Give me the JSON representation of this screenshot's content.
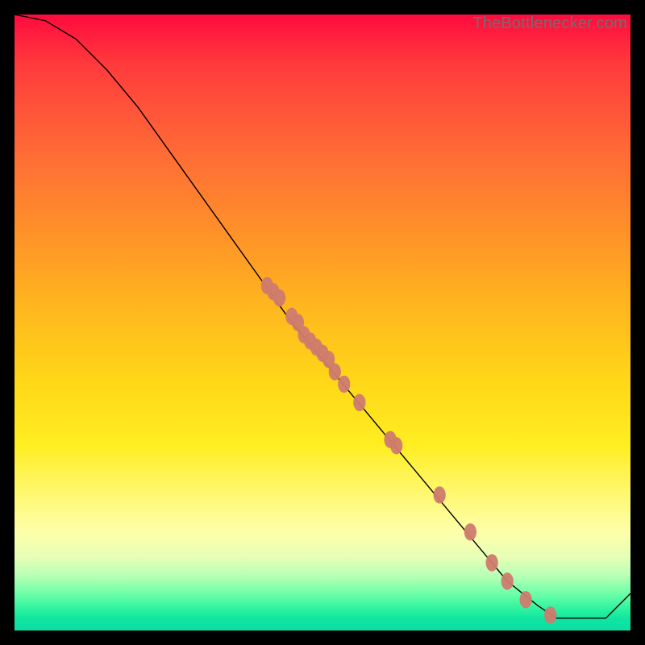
{
  "watermark": "TheBottlenecker.com",
  "chart_data": {
    "type": "line",
    "title": "",
    "xlabel": "",
    "ylabel": "",
    "xlim": [
      0,
      100
    ],
    "ylim": [
      0,
      100
    ],
    "grid": false,
    "curve": {
      "name": "bottleneck-curve",
      "color": "#000000",
      "x": [
        0,
        5,
        10,
        15,
        20,
        25,
        30,
        35,
        40,
        45,
        50,
        55,
        60,
        65,
        70,
        75,
        80,
        85,
        88,
        92,
        96,
        100
      ],
      "y": [
        100,
        99,
        96,
        91,
        85,
        78,
        71,
        64,
        57,
        50,
        44,
        38,
        32,
        26,
        20,
        14,
        8,
        4,
        2,
        2,
        2,
        6
      ]
    },
    "points": {
      "name": "sample-points",
      "color": "#cf7b6e",
      "data": [
        {
          "x": 41,
          "y": 56
        },
        {
          "x": 42,
          "y": 55
        },
        {
          "x": 43,
          "y": 54
        },
        {
          "x": 45,
          "y": 51
        },
        {
          "x": 46,
          "y": 50
        },
        {
          "x": 47,
          "y": 48
        },
        {
          "x": 48,
          "y": 47
        },
        {
          "x": 49,
          "y": 46
        },
        {
          "x": 50,
          "y": 45
        },
        {
          "x": 51,
          "y": 44
        },
        {
          "x": 52,
          "y": 42
        },
        {
          "x": 53.5,
          "y": 40
        },
        {
          "x": 56,
          "y": 37
        },
        {
          "x": 61,
          "y": 31
        },
        {
          "x": 62,
          "y": 30
        },
        {
          "x": 69,
          "y": 22
        },
        {
          "x": 74,
          "y": 16
        },
        {
          "x": 77.5,
          "y": 11
        },
        {
          "x": 80,
          "y": 8
        },
        {
          "x": 83,
          "y": 5
        },
        {
          "x": 87,
          "y": 2.5
        }
      ]
    }
  }
}
